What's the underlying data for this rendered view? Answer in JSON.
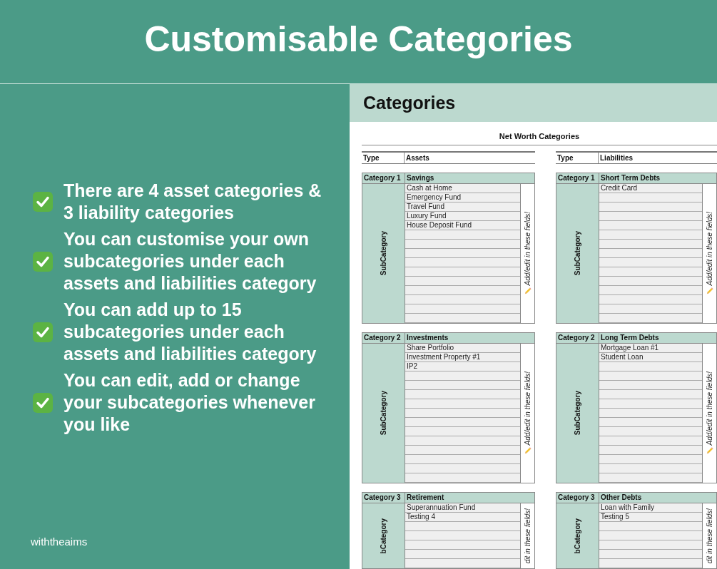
{
  "header": {
    "title": "Customisable Categories"
  },
  "features": [
    {
      "text": "There are 4 asset categories & 3 liability categories"
    },
    {
      "text": "You can customise your own subcategories under each assets and liabilities category"
    },
    {
      "text": "You can add up to 15 subcategories under each assets and liabilities category"
    },
    {
      "text": "You can edit, add or change your subcategories whenever you like"
    }
  ],
  "brand": "withtheaims",
  "sheet": {
    "tab_title": "Categories",
    "title": "Net Worth Categories",
    "sections": [
      {
        "type_label": "Type",
        "type_value": "Assets",
        "categories": [
          {
            "label": "Category 1",
            "name": "Savings",
            "side_label": "SubCategory",
            "note": "Add/edit in these fields!",
            "cut_off": false,
            "subcategories": [
              "Cash at Home",
              "Emergency Fund",
              "Travel Fund",
              "Luxury Fund",
              "House Deposit Fund"
            ]
          },
          {
            "label": "Category 2",
            "name": "Investments",
            "side_label": "SubCategory",
            "note": "Add/edit in these fields!",
            "cut_off": false,
            "subcategories": [
              "Share Portfolio",
              "Investment Property #1",
              "IP2"
            ]
          },
          {
            "label": "Category 3",
            "name": "Retirement",
            "side_label": "bCategory",
            "note": "dit in these fields!",
            "cut_off": true,
            "subcategories": [
              "Superannuation Fund",
              "Testing 4"
            ]
          }
        ]
      },
      {
        "type_label": "Type",
        "type_value": "Liabilities",
        "categories": [
          {
            "label": "Category 1",
            "name": "Short Term Debts",
            "side_label": "SubCategory",
            "note": "Add/edit in these fields!",
            "cut_off": false,
            "subcategories": [
              "Credit Card"
            ]
          },
          {
            "label": "Category 2",
            "name": "Long Term Debts",
            "side_label": "SubCategory",
            "note": "Add/edit in these fields!",
            "cut_off": false,
            "subcategories": [
              "Mortgage Loan #1",
              "Student Loan"
            ]
          },
          {
            "label": "Category 3",
            "name": "Other Debts",
            "side_label": "bCategory",
            "note": "dit in these fields!",
            "cut_off": true,
            "subcategories": [
              "Loan with Family",
              "Testing 5"
            ]
          }
        ]
      }
    ]
  }
}
